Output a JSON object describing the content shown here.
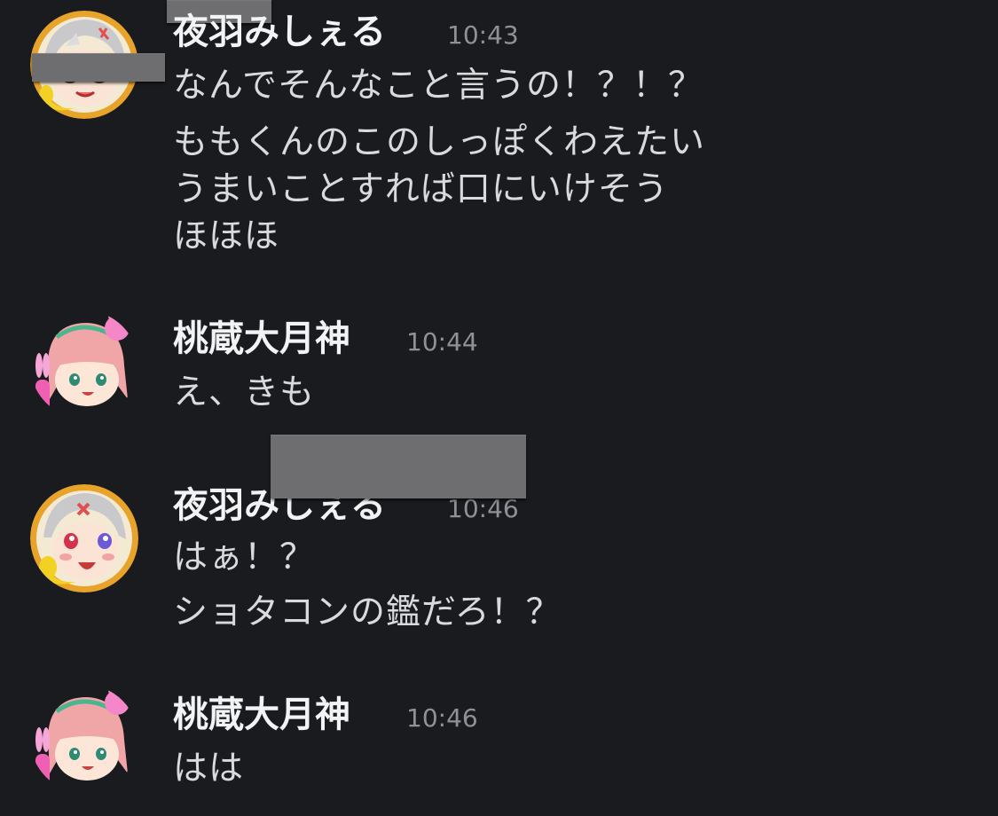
{
  "messages": [
    {
      "author": "夜羽みしぇる",
      "time": "10:43",
      "avatar": "misheru-avatar",
      "lines": [
        "なんでそんなこと言うの！？！？",
        "ももくんのこのしっぽくわえたい",
        "うまいことすれば口にいけそう",
        "ほほほ"
      ]
    },
    {
      "author": "桃蔵大月神",
      "time": "10:44",
      "avatar": "momozo-avatar",
      "lines": [
        "え、きも"
      ]
    },
    {
      "author": "夜羽みしぇる",
      "time": "10:46",
      "avatar": "misheru-avatar",
      "lines": [
        "はぁ！？",
        "ショタコンの鑑だろ！？"
      ]
    },
    {
      "author": "桃蔵大月神",
      "time": "10:46",
      "avatar": "momozo-avatar",
      "lines": [
        "はは"
      ]
    }
  ],
  "colors": {
    "background": "#1a1b1f",
    "author": "#f2f3f5",
    "timestamp": "#8e9297",
    "text": "#d9dadc",
    "redaction": "#6e6e70"
  }
}
